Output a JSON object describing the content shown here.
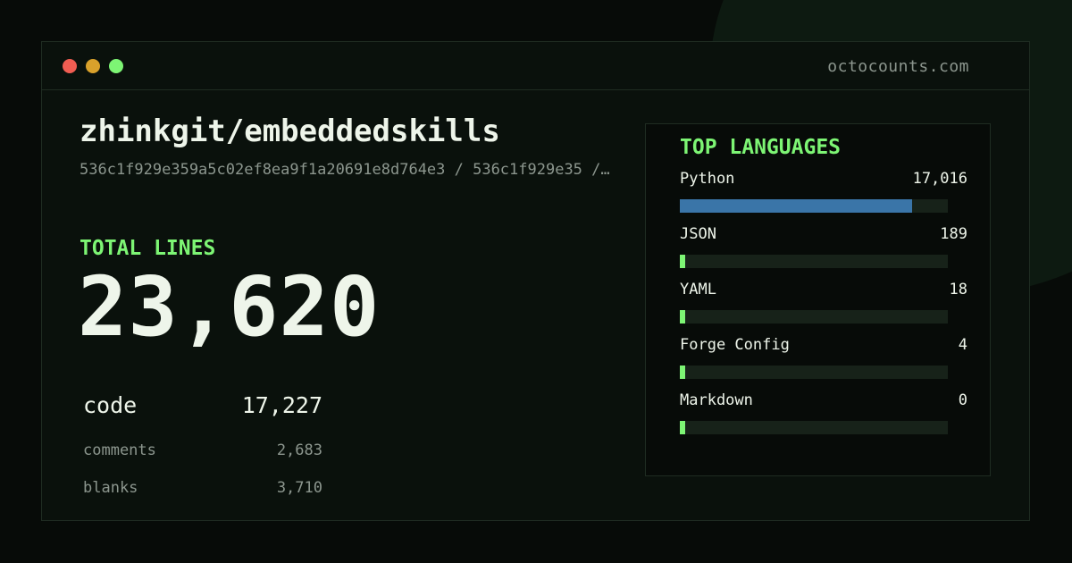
{
  "window": {
    "site": "octocounts.com"
  },
  "repo": {
    "title": "zhinkgit/embeddedskills",
    "commit_line": "536c1f929e359a5c02ef8ea9f1a20691e8d764e3 / 536c1f929e35 /…"
  },
  "totals": {
    "label": "TOTAL LINES",
    "value": "23,620"
  },
  "breakdown": [
    {
      "label": "code",
      "value": "17,227"
    },
    {
      "label": "comments",
      "value": "2,683"
    },
    {
      "label": "blanks",
      "value": "3,710"
    }
  ],
  "languages": {
    "heading": "TOP LANGUAGES",
    "items": [
      {
        "name": "Python",
        "count": "17,016",
        "share": 0.866,
        "color": "#3a75a8"
      },
      {
        "name": "JSON",
        "count": "189",
        "share": 0.02,
        "color": "#7df574"
      },
      {
        "name": "YAML",
        "count": "18",
        "share": 0.02,
        "color": "#7df574"
      },
      {
        "name": "Forge Config",
        "count": "4",
        "share": 0.02,
        "color": "#7df574"
      },
      {
        "name": "Markdown",
        "count": "0",
        "share": 0.02,
        "color": "#7df574"
      }
    ]
  },
  "colors": {
    "accent": "#7df574",
    "text": "#eef5ea",
    "muted": "#8c968e",
    "background": "#070b08"
  }
}
